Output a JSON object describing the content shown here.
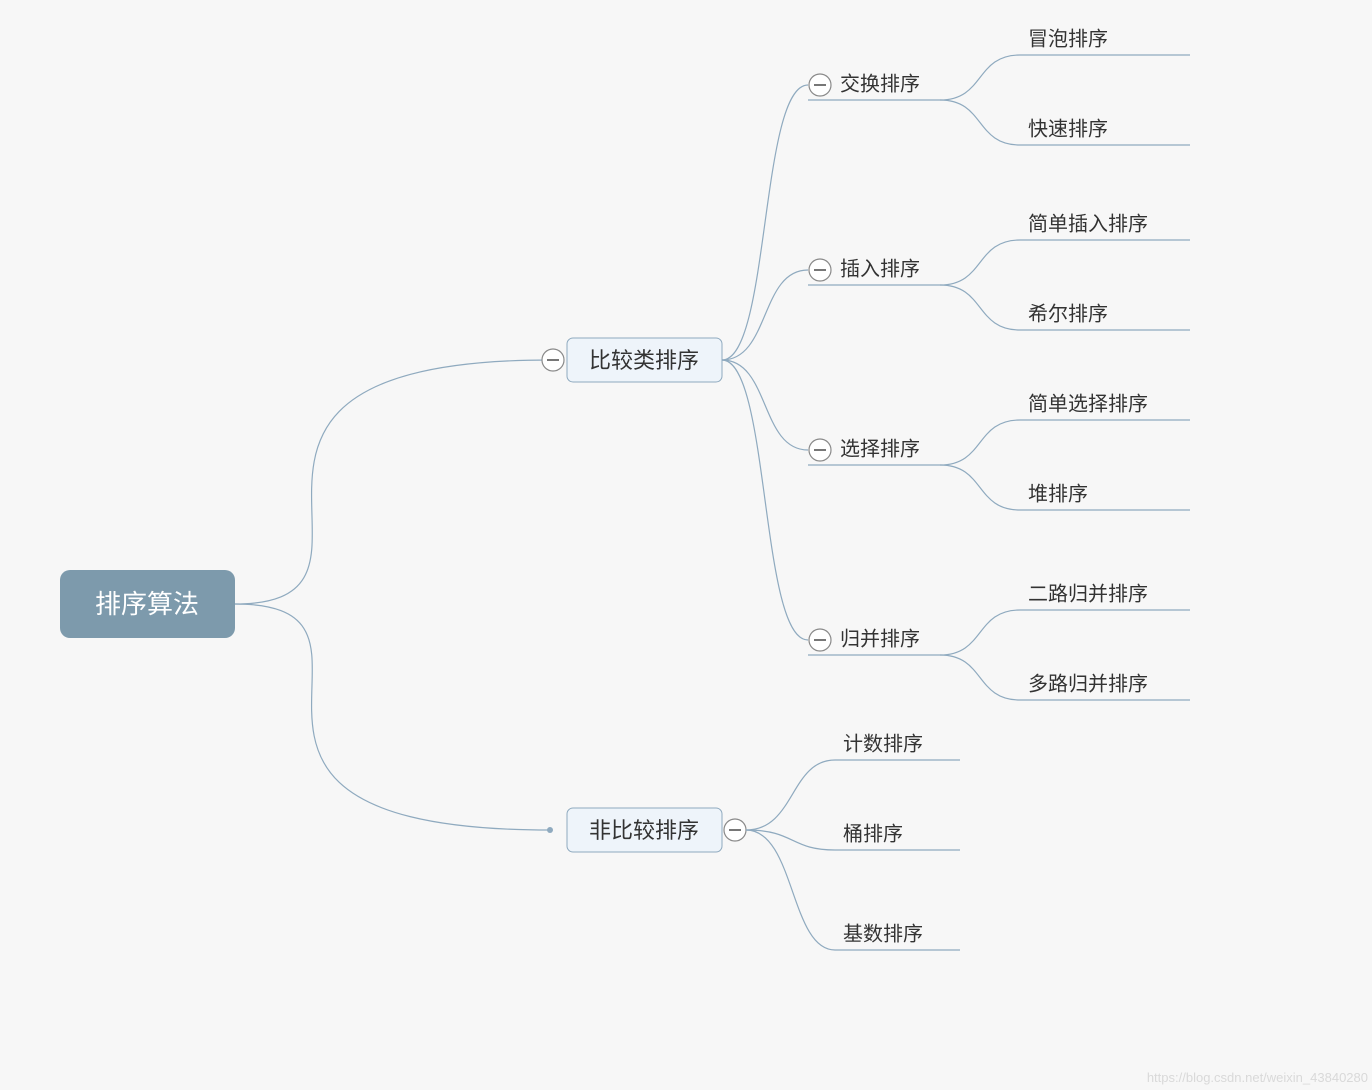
{
  "root": {
    "label": "排序算法"
  },
  "categories": [
    {
      "key": "comparison",
      "label": "比较类排序",
      "groups": [
        {
          "key": "swap",
          "label": "交换排序",
          "leaves": [
            "冒泡排序",
            "快速排序"
          ]
        },
        {
          "key": "insert",
          "label": "插入排序",
          "leaves": [
            "简单插入排序",
            "希尔排序"
          ]
        },
        {
          "key": "select",
          "label": "选择排序",
          "leaves": [
            "简单选择排序",
            "堆排序"
          ]
        },
        {
          "key": "merge",
          "label": "归并排序",
          "leaves": [
            "二路归并排序",
            "多路归并排序"
          ]
        }
      ]
    },
    {
      "key": "noncomparison",
      "label": "非比较排序",
      "leaves": [
        "计数排序",
        "桶排序",
        "基数排序"
      ]
    }
  ],
  "watermark": "https://blog.csdn.net/weixin_43840280"
}
